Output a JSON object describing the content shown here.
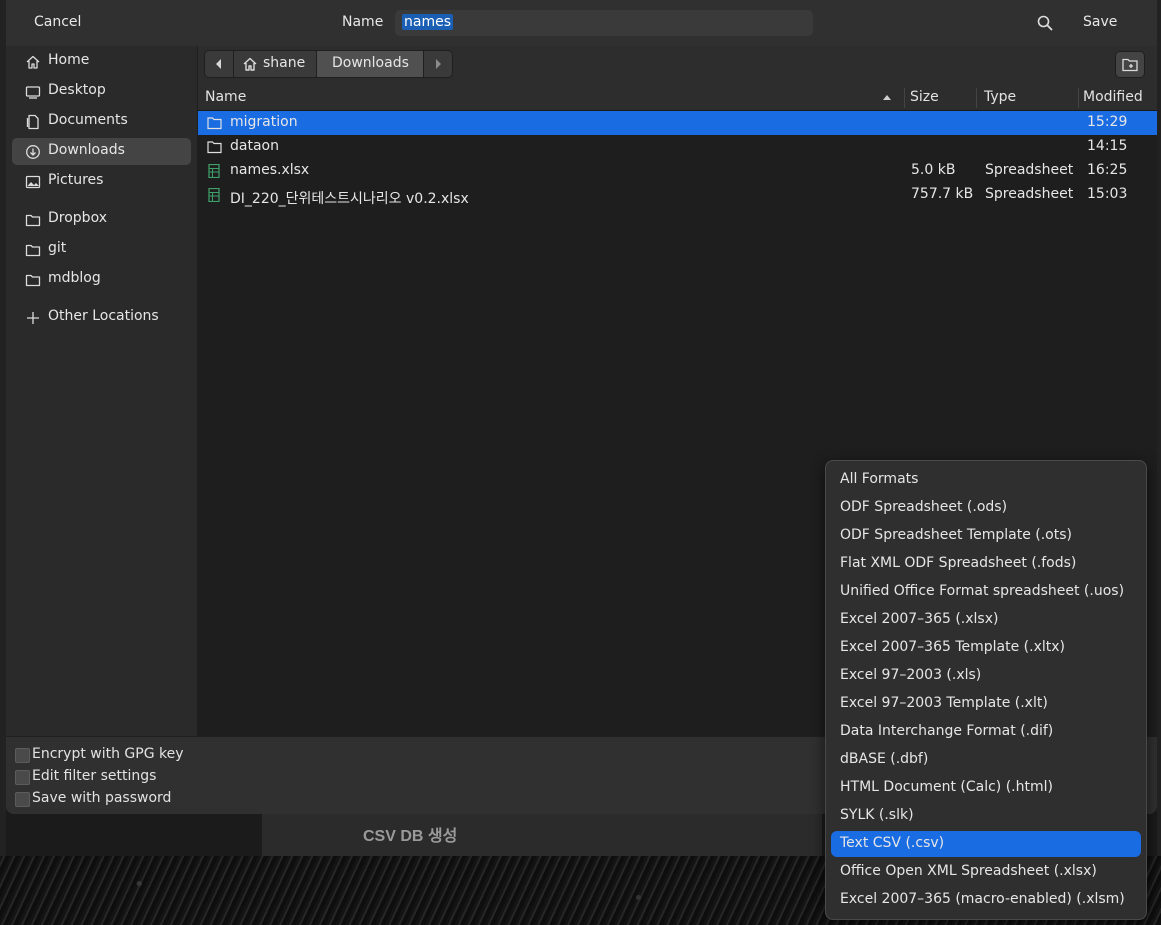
{
  "header": {
    "cancel_label": "Cancel",
    "name_label": "Name",
    "filename_value": "names",
    "save_label": "Save",
    "search_icon": "search-icon"
  },
  "sidebar": {
    "items": [
      {
        "label": "Home",
        "icon": "home-icon",
        "active": false
      },
      {
        "label": "Desktop",
        "icon": "desktop-icon",
        "active": false
      },
      {
        "label": "Documents",
        "icon": "documents-icon",
        "active": false
      },
      {
        "label": "Downloads",
        "icon": "download-icon",
        "active": true
      },
      {
        "label": "Pictures",
        "icon": "pictures-icon",
        "active": false
      },
      {
        "label": "Dropbox",
        "icon": "folder-icon",
        "active": false
      },
      {
        "label": "git",
        "icon": "folder-icon",
        "active": false
      },
      {
        "label": "mdblog",
        "icon": "folder-icon",
        "active": false
      },
      {
        "label": "Other Locations",
        "icon": "plus-icon",
        "active": false
      }
    ]
  },
  "pathbar": {
    "home_label": "shane",
    "current_label": "Downloads"
  },
  "filelist": {
    "columns": {
      "name": "Name",
      "size": "Size",
      "type": "Type",
      "modified": "Modified"
    },
    "rows": [
      {
        "name": "migration",
        "size": "",
        "type": "",
        "modified": "15:29",
        "kind": "folder",
        "selected": true
      },
      {
        "name": "dataon",
        "size": "",
        "type": "",
        "modified": "14:15",
        "kind": "folder",
        "selected": false
      },
      {
        "name": "names.xlsx",
        "size": "5.0 kB",
        "type": "Spreadsheet",
        "modified": "16:25",
        "kind": "spreadsheet",
        "selected": false
      },
      {
        "name": "DI_220_단위테스트시나리오 v0.2.xlsx",
        "size": "757.7 kB",
        "type": "Spreadsheet",
        "modified": "15:03",
        "kind": "spreadsheet",
        "selected": false
      }
    ]
  },
  "options": {
    "encrypt_label": "Encrypt with GPG key",
    "filter_label": "Edit filter settings",
    "password_label": "Save with password"
  },
  "format_popup": {
    "items": [
      "All Formats",
      "ODF Spreadsheet (.ods)",
      "ODF Spreadsheet Template (.ots)",
      "Flat XML ODF Spreadsheet (.fods)",
      "Unified Office Format spreadsheet (.uos)",
      "Excel 2007–365 (.xlsx)",
      "Excel 2007–365 Template (.xltx)",
      "Excel 97–2003 (.xls)",
      "Excel 97–2003 Template (.xlt)",
      "Data Interchange Format (.dif)",
      "dBASE (.dbf)",
      "HTML Document (Calc) (.html)",
      "SYLK (.slk)",
      "Text CSV (.csv)",
      "Office Open XML Spreadsheet (.xlsx)",
      "Excel 2007–365 (macro-enabled) (.xlsm)"
    ],
    "selected": "Text CSV (.csv)"
  },
  "background": {
    "caption": "CSV DB 생성"
  },
  "colors": {
    "selection": "#1a6ce3",
    "dialog_bg": "#2d2d2d",
    "list_bg": "#1e1e1e",
    "spreadsheet_icon": "#3fa06a"
  }
}
